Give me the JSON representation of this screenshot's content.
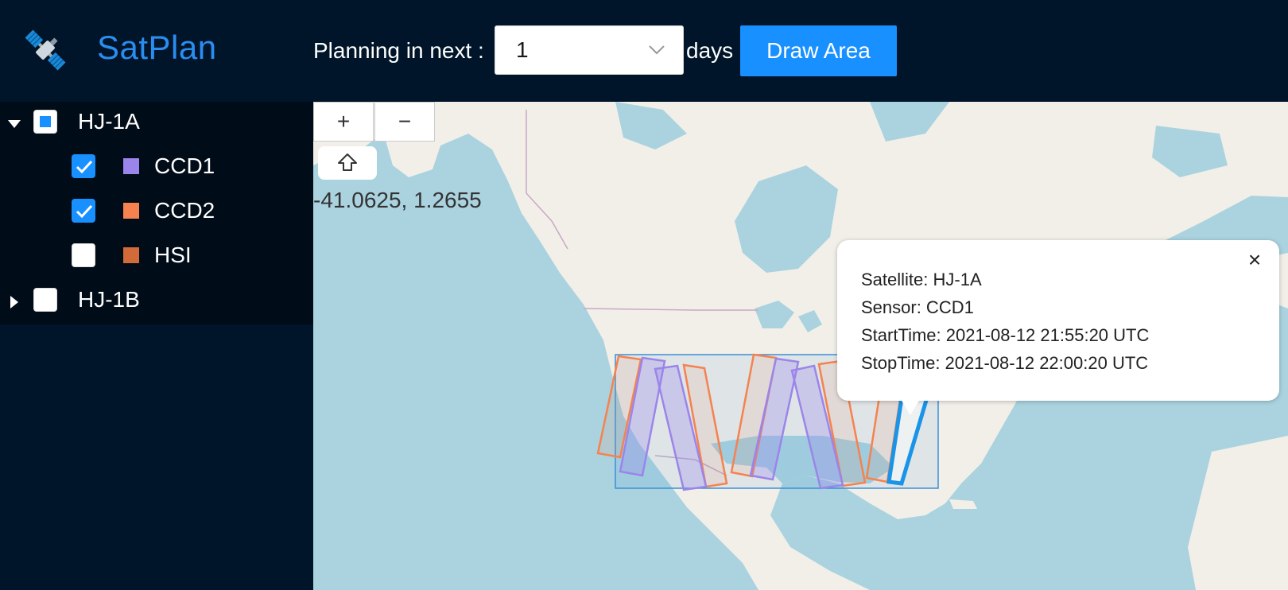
{
  "header": {
    "app_name": "SatPlan",
    "logo_icon": "satellite-icon",
    "planning_label": "Planning in next :",
    "days_value": "1",
    "days_label": "days",
    "draw_button": "Draw Area"
  },
  "tree": [
    {
      "label": "HJ-1A",
      "expanded": true,
      "state": "indeterminate",
      "children": [
        {
          "label": "CCD1",
          "checked": true,
          "color": "#9b85ea"
        },
        {
          "label": "CCD2",
          "checked": true,
          "color": "#f5824f"
        },
        {
          "label": "HSI",
          "checked": false,
          "color": "#d26b39"
        }
      ]
    },
    {
      "label": "HJ-1B",
      "expanded": false,
      "state": "unchecked"
    }
  ],
  "map": {
    "zoom_in": "+",
    "zoom_out": "−",
    "home_icon": "arrow-up-icon",
    "coordinates": "-41.0625, 1.2655",
    "colors": {
      "ccd1": "#9b85ea",
      "ccd2": "#f5824f",
      "selected": "#1a94e8",
      "area": "#3a8fd6"
    }
  },
  "popup": {
    "satellite": "Satellite: HJ-1A",
    "sensor": "Sensor: CCD1",
    "start": "StartTime: 2021-08-12 21:55:20 UTC",
    "stop": "StopTime: 2021-08-12 22:00:20 UTC",
    "close": "×"
  }
}
